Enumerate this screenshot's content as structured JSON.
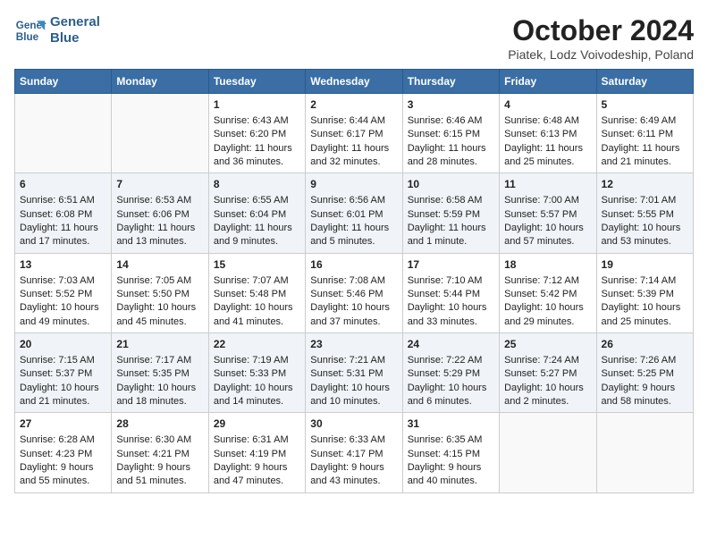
{
  "header": {
    "logo_line1": "General",
    "logo_line2": "Blue",
    "title": "October 2024",
    "subtitle": "Piatek, Lodz Voivodeship, Poland"
  },
  "days_of_week": [
    "Sunday",
    "Monday",
    "Tuesday",
    "Wednesday",
    "Thursday",
    "Friday",
    "Saturday"
  ],
  "weeks": [
    [
      {
        "day": "",
        "info": ""
      },
      {
        "day": "",
        "info": ""
      },
      {
        "day": "1",
        "info": "Sunrise: 6:43 AM\nSunset: 6:20 PM\nDaylight: 11 hours and 36 minutes."
      },
      {
        "day": "2",
        "info": "Sunrise: 6:44 AM\nSunset: 6:17 PM\nDaylight: 11 hours and 32 minutes."
      },
      {
        "day": "3",
        "info": "Sunrise: 6:46 AM\nSunset: 6:15 PM\nDaylight: 11 hours and 28 minutes."
      },
      {
        "day": "4",
        "info": "Sunrise: 6:48 AM\nSunset: 6:13 PM\nDaylight: 11 hours and 25 minutes."
      },
      {
        "day": "5",
        "info": "Sunrise: 6:49 AM\nSunset: 6:11 PM\nDaylight: 11 hours and 21 minutes."
      }
    ],
    [
      {
        "day": "6",
        "info": "Sunrise: 6:51 AM\nSunset: 6:08 PM\nDaylight: 11 hours and 17 minutes."
      },
      {
        "day": "7",
        "info": "Sunrise: 6:53 AM\nSunset: 6:06 PM\nDaylight: 11 hours and 13 minutes."
      },
      {
        "day": "8",
        "info": "Sunrise: 6:55 AM\nSunset: 6:04 PM\nDaylight: 11 hours and 9 minutes."
      },
      {
        "day": "9",
        "info": "Sunrise: 6:56 AM\nSunset: 6:01 PM\nDaylight: 11 hours and 5 minutes."
      },
      {
        "day": "10",
        "info": "Sunrise: 6:58 AM\nSunset: 5:59 PM\nDaylight: 11 hours and 1 minute."
      },
      {
        "day": "11",
        "info": "Sunrise: 7:00 AM\nSunset: 5:57 PM\nDaylight: 10 hours and 57 minutes."
      },
      {
        "day": "12",
        "info": "Sunrise: 7:01 AM\nSunset: 5:55 PM\nDaylight: 10 hours and 53 minutes."
      }
    ],
    [
      {
        "day": "13",
        "info": "Sunrise: 7:03 AM\nSunset: 5:52 PM\nDaylight: 10 hours and 49 minutes."
      },
      {
        "day": "14",
        "info": "Sunrise: 7:05 AM\nSunset: 5:50 PM\nDaylight: 10 hours and 45 minutes."
      },
      {
        "day": "15",
        "info": "Sunrise: 7:07 AM\nSunset: 5:48 PM\nDaylight: 10 hours and 41 minutes."
      },
      {
        "day": "16",
        "info": "Sunrise: 7:08 AM\nSunset: 5:46 PM\nDaylight: 10 hours and 37 minutes."
      },
      {
        "day": "17",
        "info": "Sunrise: 7:10 AM\nSunset: 5:44 PM\nDaylight: 10 hours and 33 minutes."
      },
      {
        "day": "18",
        "info": "Sunrise: 7:12 AM\nSunset: 5:42 PM\nDaylight: 10 hours and 29 minutes."
      },
      {
        "day": "19",
        "info": "Sunrise: 7:14 AM\nSunset: 5:39 PM\nDaylight: 10 hours and 25 minutes."
      }
    ],
    [
      {
        "day": "20",
        "info": "Sunrise: 7:15 AM\nSunset: 5:37 PM\nDaylight: 10 hours and 21 minutes."
      },
      {
        "day": "21",
        "info": "Sunrise: 7:17 AM\nSunset: 5:35 PM\nDaylight: 10 hours and 18 minutes."
      },
      {
        "day": "22",
        "info": "Sunrise: 7:19 AM\nSunset: 5:33 PM\nDaylight: 10 hours and 14 minutes."
      },
      {
        "day": "23",
        "info": "Sunrise: 7:21 AM\nSunset: 5:31 PM\nDaylight: 10 hours and 10 minutes."
      },
      {
        "day": "24",
        "info": "Sunrise: 7:22 AM\nSunset: 5:29 PM\nDaylight: 10 hours and 6 minutes."
      },
      {
        "day": "25",
        "info": "Sunrise: 7:24 AM\nSunset: 5:27 PM\nDaylight: 10 hours and 2 minutes."
      },
      {
        "day": "26",
        "info": "Sunrise: 7:26 AM\nSunset: 5:25 PM\nDaylight: 9 hours and 58 minutes."
      }
    ],
    [
      {
        "day": "27",
        "info": "Sunrise: 6:28 AM\nSunset: 4:23 PM\nDaylight: 9 hours and 55 minutes."
      },
      {
        "day": "28",
        "info": "Sunrise: 6:30 AM\nSunset: 4:21 PM\nDaylight: 9 hours and 51 minutes."
      },
      {
        "day": "29",
        "info": "Sunrise: 6:31 AM\nSunset: 4:19 PM\nDaylight: 9 hours and 47 minutes."
      },
      {
        "day": "30",
        "info": "Sunrise: 6:33 AM\nSunset: 4:17 PM\nDaylight: 9 hours and 43 minutes."
      },
      {
        "day": "31",
        "info": "Sunrise: 6:35 AM\nSunset: 4:15 PM\nDaylight: 9 hours and 40 minutes."
      },
      {
        "day": "",
        "info": ""
      },
      {
        "day": "",
        "info": ""
      }
    ]
  ]
}
